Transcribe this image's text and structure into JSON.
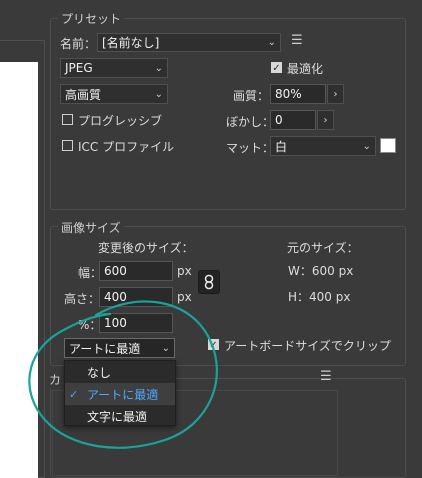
{
  "preset": {
    "legend": "プリセット",
    "name_label": "名前：",
    "name_value": "[名前なし]",
    "format_value": "JPEG",
    "quality_preset_value": "高画質",
    "optimize_label": "最適化",
    "optimize_checked": true,
    "quality_label": "画質：",
    "quality_value": "80%",
    "progressive_label": "プログレッシブ",
    "progressive_checked": false,
    "blur_label": "ぼかし：",
    "blur_value": "0",
    "icc_label": "ICC プロファイル",
    "icc_checked": false,
    "matte_label": "マット：",
    "matte_value": "白",
    "matte_color": "#ffffff"
  },
  "image_size": {
    "legend": "画像サイズ",
    "new_size_label": "変更後のサイズ：",
    "width_label": "幅：",
    "width_value": "600",
    "height_label": "高さ：",
    "height_value": "400",
    "unit": "px",
    "percent_label": "%：",
    "percent_value": "100",
    "original_label": "元のサイズ：",
    "original_width": "W：600 px",
    "original_height": "H：400 px",
    "resample_value": "アートに最適",
    "clip_label": "アートボードサイズでクリップ",
    "clip_checked": true
  },
  "resample_menu": {
    "items": [
      "なし",
      "アートに最適",
      "文字に最適"
    ],
    "selected_index": 1
  },
  "color_section": {
    "legend_partial": "カ"
  },
  "annotation_color": "#1aa39a",
  "accent_color": "#4fa8ff"
}
